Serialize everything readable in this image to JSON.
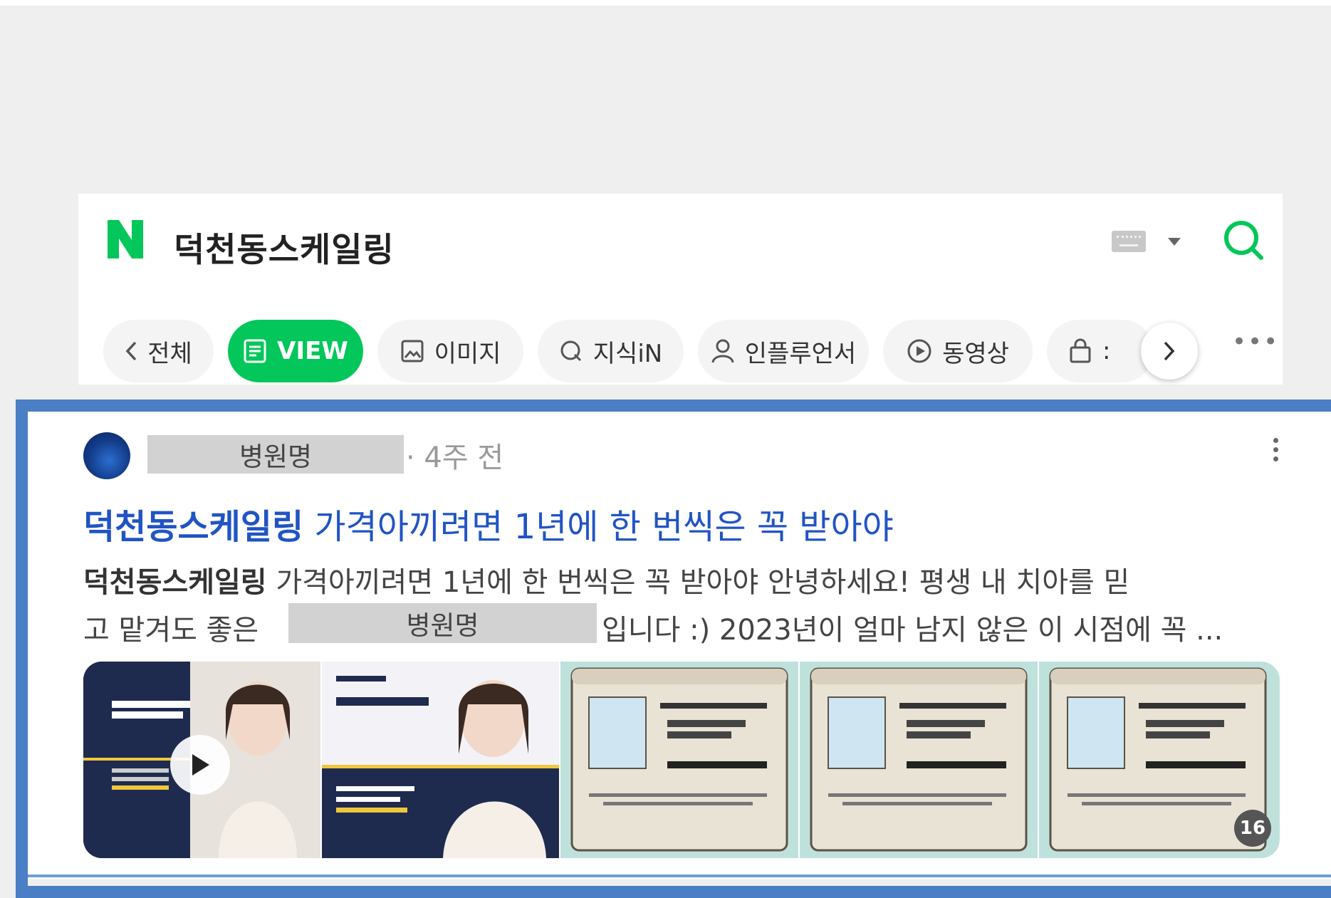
{
  "search": {
    "query": "덕천동스케일링"
  },
  "tabs": [
    {
      "label": "전체"
    },
    {
      "label": "VIEW"
    },
    {
      "label": "이미지"
    },
    {
      "label": "지식iN"
    },
    {
      "label": "인플루언서"
    },
    {
      "label": "동영상"
    },
    {
      "label": ":"
    }
  ],
  "post": {
    "author": "병원명",
    "time": "· 4주 전",
    "title_highlight": "덕천동스케일링",
    "title_rest": " 가격아끼려면 1년에 한 번씩은 꼭 받아야",
    "desc_highlight": "덕천동스케일링",
    "desc_line1_rest": " 가격아끼려면 1년에 한 번씩은 꼭 받아야 안녕하세요! 평생 내 치아를 믿",
    "desc_line2_pre": "고 맡겨도 좋은",
    "desc_redact": "병원명",
    "desc_line2_post": "입니다 :) 2023년이 얼마 남지 않은 이 시점에 꼭 ...",
    "image_count": "16"
  },
  "colors": {
    "brand": "#03c75a",
    "link": "#2154c4",
    "highlight": "#4a7ec5"
  }
}
